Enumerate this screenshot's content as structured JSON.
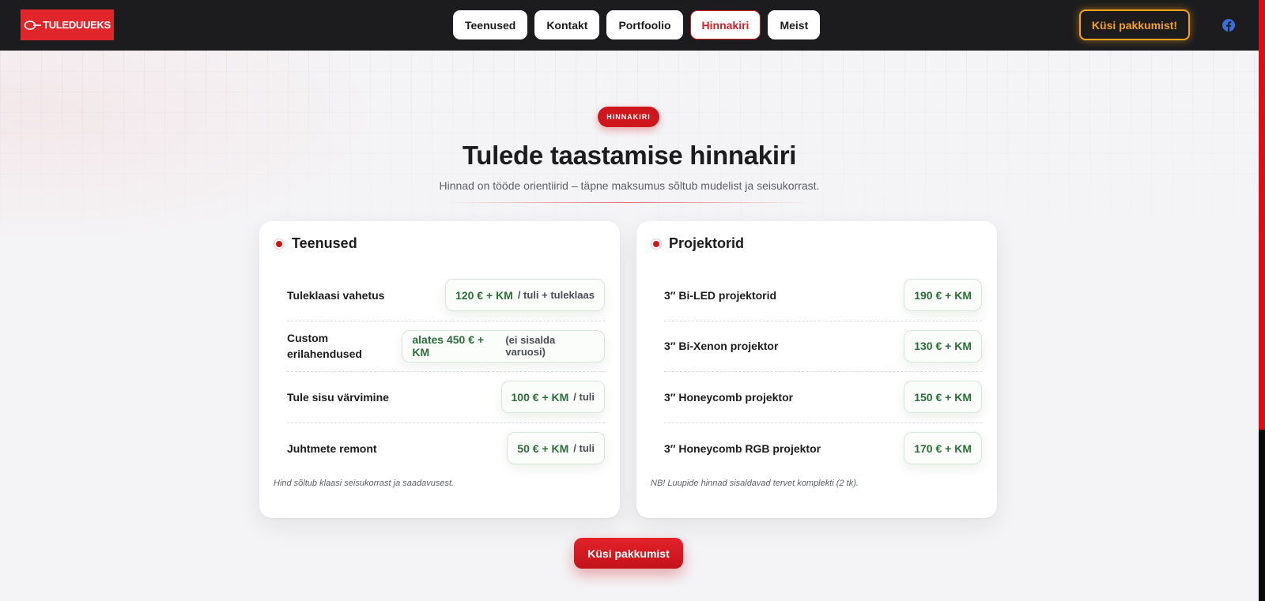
{
  "header": {
    "logo_text": "TULEDUUEKS",
    "nav": [
      {
        "label": "Teenused",
        "active": false
      },
      {
        "label": "Kontakt",
        "active": false
      },
      {
        "label": "Portfoolio",
        "active": false
      },
      {
        "label": "Hinnakiri",
        "active": true
      },
      {
        "label": "Meist",
        "active": false
      }
    ],
    "cta_label": "Küsi pakkumist!",
    "social_icon": "facebook-icon"
  },
  "hero": {
    "badge": "HINNAKIRI",
    "title": "Tulede taastamise hinnakiri",
    "subtitle": "Hinnad on tööde orientiirid – täpne maksumus sõltub mudelist ja seisukorrast."
  },
  "cards": [
    {
      "title": "Teenused",
      "rows": [
        {
          "label": "Tuleklaasi vahetus",
          "price": "120 € + KM",
          "unit": "/ tuli + tuleklaas"
        },
        {
          "label": "Custom erilahendused",
          "price": "alates 450 € + KM",
          "unit": "(ei sisalda varuosi)"
        },
        {
          "label": "Tule sisu värvimine",
          "price": "100 € + KM",
          "unit": "/ tuli"
        },
        {
          "label": "Juhtmete remont",
          "price": "50 € + KM",
          "unit": "/ tuli"
        }
      ],
      "note": "Hind sõltub klaasi seisukorrast ja saadavusest."
    },
    {
      "title": "Projektorid",
      "rows": [
        {
          "label": "3″ Bi-LED projektorid",
          "price": "190 € + KM",
          "unit": ""
        },
        {
          "label": "3″ Bi-Xenon projektor",
          "price": "130 € + KM",
          "unit": ""
        },
        {
          "label": "3″ Honeycomb projektor",
          "price": "150 € + KM",
          "unit": ""
        },
        {
          "label": "3″ Honeycomb RGB projektor",
          "price": "170 € + KM",
          "unit": ""
        }
      ],
      "note": "NB! Luupide hinnad sisaldavad tervet komplekti (2 tk)."
    }
  ],
  "bottom_cta_label": "Küsi pakkumist",
  "colors": {
    "brand_red": "#d0161d",
    "header_bg": "#1c1c1e",
    "cta_orange": "#f4a21d",
    "price_green": "#2b6e3a",
    "page_bg": "#f4f4f6"
  }
}
